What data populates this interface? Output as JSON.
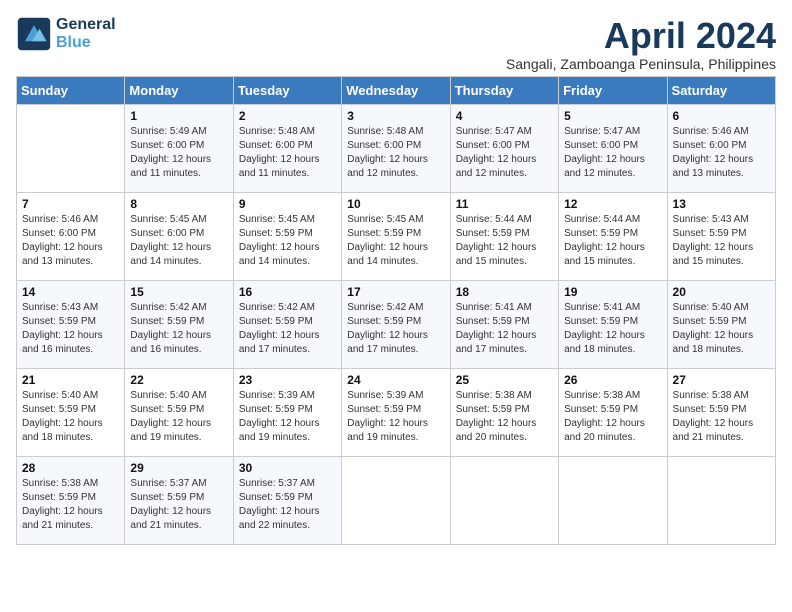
{
  "header": {
    "logo_line1": "General",
    "logo_line2": "Blue",
    "month_title": "April 2024",
    "subtitle": "Sangali, Zamboanga Peninsula, Philippines"
  },
  "weekdays": [
    "Sunday",
    "Monday",
    "Tuesday",
    "Wednesday",
    "Thursday",
    "Friday",
    "Saturday"
  ],
  "weeks": [
    [
      {
        "day": "",
        "info": ""
      },
      {
        "day": "1",
        "info": "Sunrise: 5:49 AM\nSunset: 6:00 PM\nDaylight: 12 hours\nand 11 minutes."
      },
      {
        "day": "2",
        "info": "Sunrise: 5:48 AM\nSunset: 6:00 PM\nDaylight: 12 hours\nand 11 minutes."
      },
      {
        "day": "3",
        "info": "Sunrise: 5:48 AM\nSunset: 6:00 PM\nDaylight: 12 hours\nand 12 minutes."
      },
      {
        "day": "4",
        "info": "Sunrise: 5:47 AM\nSunset: 6:00 PM\nDaylight: 12 hours\nand 12 minutes."
      },
      {
        "day": "5",
        "info": "Sunrise: 5:47 AM\nSunset: 6:00 PM\nDaylight: 12 hours\nand 12 minutes."
      },
      {
        "day": "6",
        "info": "Sunrise: 5:46 AM\nSunset: 6:00 PM\nDaylight: 12 hours\nand 13 minutes."
      }
    ],
    [
      {
        "day": "7",
        "info": "Sunrise: 5:46 AM\nSunset: 6:00 PM\nDaylight: 12 hours\nand 13 minutes."
      },
      {
        "day": "8",
        "info": "Sunrise: 5:45 AM\nSunset: 6:00 PM\nDaylight: 12 hours\nand 14 minutes."
      },
      {
        "day": "9",
        "info": "Sunrise: 5:45 AM\nSunset: 5:59 PM\nDaylight: 12 hours\nand 14 minutes."
      },
      {
        "day": "10",
        "info": "Sunrise: 5:45 AM\nSunset: 5:59 PM\nDaylight: 12 hours\nand 14 minutes."
      },
      {
        "day": "11",
        "info": "Sunrise: 5:44 AM\nSunset: 5:59 PM\nDaylight: 12 hours\nand 15 minutes."
      },
      {
        "day": "12",
        "info": "Sunrise: 5:44 AM\nSunset: 5:59 PM\nDaylight: 12 hours\nand 15 minutes."
      },
      {
        "day": "13",
        "info": "Sunrise: 5:43 AM\nSunset: 5:59 PM\nDaylight: 12 hours\nand 15 minutes."
      }
    ],
    [
      {
        "day": "14",
        "info": "Sunrise: 5:43 AM\nSunset: 5:59 PM\nDaylight: 12 hours\nand 16 minutes."
      },
      {
        "day": "15",
        "info": "Sunrise: 5:42 AM\nSunset: 5:59 PM\nDaylight: 12 hours\nand 16 minutes."
      },
      {
        "day": "16",
        "info": "Sunrise: 5:42 AM\nSunset: 5:59 PM\nDaylight: 12 hours\nand 17 minutes."
      },
      {
        "day": "17",
        "info": "Sunrise: 5:42 AM\nSunset: 5:59 PM\nDaylight: 12 hours\nand 17 minutes."
      },
      {
        "day": "18",
        "info": "Sunrise: 5:41 AM\nSunset: 5:59 PM\nDaylight: 12 hours\nand 17 minutes."
      },
      {
        "day": "19",
        "info": "Sunrise: 5:41 AM\nSunset: 5:59 PM\nDaylight: 12 hours\nand 18 minutes."
      },
      {
        "day": "20",
        "info": "Sunrise: 5:40 AM\nSunset: 5:59 PM\nDaylight: 12 hours\nand 18 minutes."
      }
    ],
    [
      {
        "day": "21",
        "info": "Sunrise: 5:40 AM\nSunset: 5:59 PM\nDaylight: 12 hours\nand 18 minutes."
      },
      {
        "day": "22",
        "info": "Sunrise: 5:40 AM\nSunset: 5:59 PM\nDaylight: 12 hours\nand 19 minutes."
      },
      {
        "day": "23",
        "info": "Sunrise: 5:39 AM\nSunset: 5:59 PM\nDaylight: 12 hours\nand 19 minutes."
      },
      {
        "day": "24",
        "info": "Sunrise: 5:39 AM\nSunset: 5:59 PM\nDaylight: 12 hours\nand 19 minutes."
      },
      {
        "day": "25",
        "info": "Sunrise: 5:38 AM\nSunset: 5:59 PM\nDaylight: 12 hours\nand 20 minutes."
      },
      {
        "day": "26",
        "info": "Sunrise: 5:38 AM\nSunset: 5:59 PM\nDaylight: 12 hours\nand 20 minutes."
      },
      {
        "day": "27",
        "info": "Sunrise: 5:38 AM\nSunset: 5:59 PM\nDaylight: 12 hours\nand 21 minutes."
      }
    ],
    [
      {
        "day": "28",
        "info": "Sunrise: 5:38 AM\nSunset: 5:59 PM\nDaylight: 12 hours\nand 21 minutes."
      },
      {
        "day": "29",
        "info": "Sunrise: 5:37 AM\nSunset: 5:59 PM\nDaylight: 12 hours\nand 21 minutes."
      },
      {
        "day": "30",
        "info": "Sunrise: 5:37 AM\nSunset: 5:59 PM\nDaylight: 12 hours\nand 22 minutes."
      },
      {
        "day": "",
        "info": ""
      },
      {
        "day": "",
        "info": ""
      },
      {
        "day": "",
        "info": ""
      },
      {
        "day": "",
        "info": ""
      }
    ]
  ]
}
